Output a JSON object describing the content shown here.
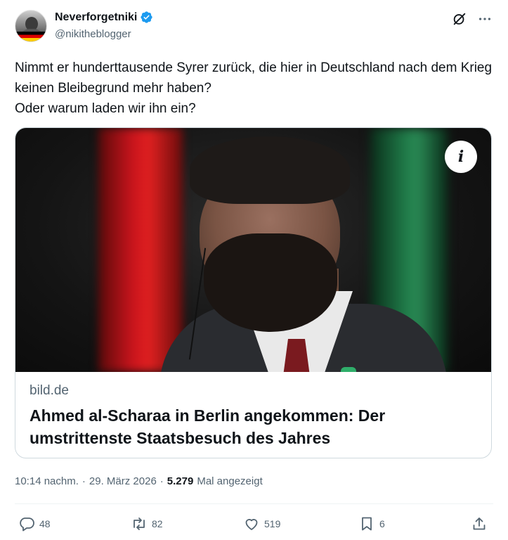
{
  "author": {
    "display_name": "Neverforgetniki",
    "handle": "@nikitheblogger",
    "verified": true,
    "avatar_icon": "profile-photo-avatar"
  },
  "top_actions": {
    "grok_icon": "grok-icon",
    "more_icon": "more-icon",
    "more_label": "···"
  },
  "tweet": {
    "text": "Nimmt er hunderttausende Syrer zurück, die hier in Deutschland nach dem Krieg keinen Bleibegrund mehr haben?\nOder warum laden wir ihn ein?"
  },
  "card": {
    "info_label": "i",
    "domain": "bild.de",
    "title": "Ahmed al-Scharaa in Berlin angekommen: Der umstrittenste Staatsbesuch des Jahres"
  },
  "meta": {
    "time": "10:14 nachm.",
    "separator": "·",
    "date": "29. März 2026",
    "separator2": "·",
    "views_count": "5.279",
    "views_label": "Mal angezeigt"
  },
  "actions": {
    "replies": "48",
    "reposts": "82",
    "likes": "519",
    "bookmarks": "6"
  },
  "colors": {
    "verified_blue": "#1d9bf0",
    "secondary_text": "#536471",
    "primary_text": "#0f1419"
  }
}
